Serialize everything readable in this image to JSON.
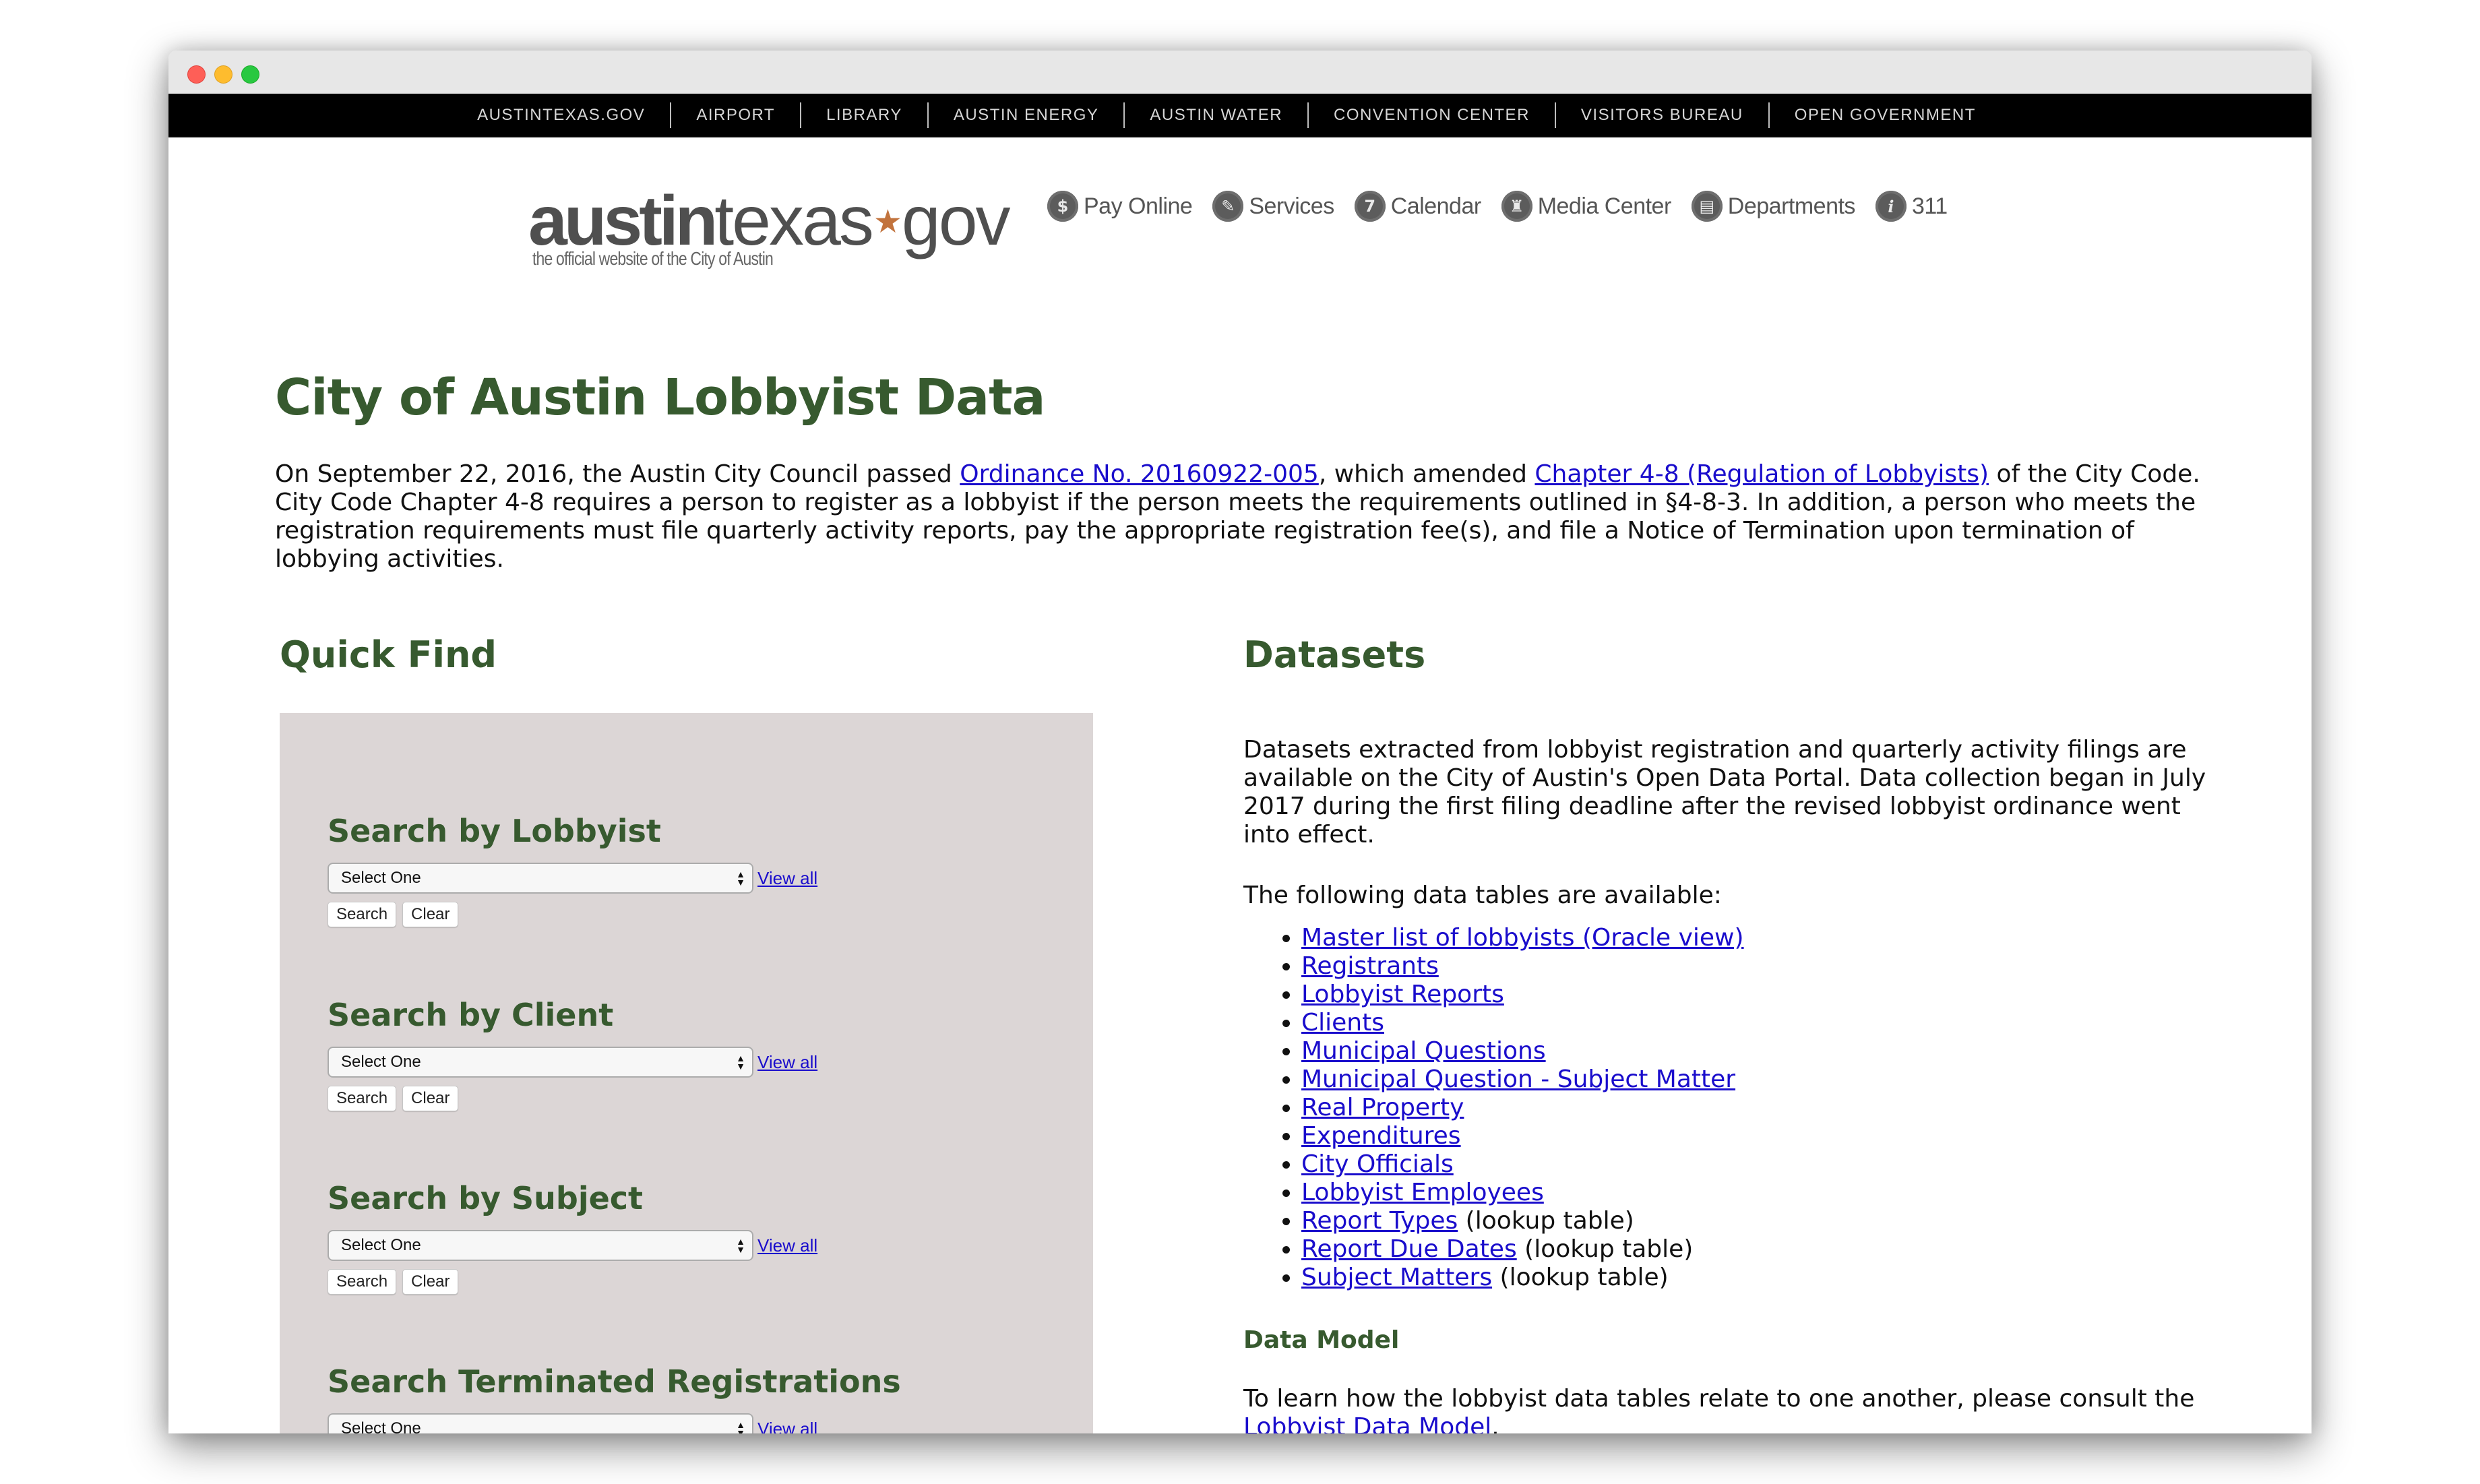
{
  "window": {
    "controls": [
      "close",
      "minimize",
      "zoom"
    ]
  },
  "top_nav": {
    "items": [
      {
        "label": "AUSTINTEXAS.GOV"
      },
      {
        "label": "AIRPORT"
      },
      {
        "label": "LIBRARY"
      },
      {
        "label": "AUSTIN ENERGY"
      },
      {
        "label": "AUSTIN WATER"
      },
      {
        "label": "CONVENTION CENTER"
      },
      {
        "label": "VISITORS BUREAU"
      },
      {
        "label": "OPEN GOVERNMENT"
      }
    ]
  },
  "logo": {
    "bold_part": "austin",
    "light_part": "texas",
    "star": "★",
    "suffix": "gov",
    "tagline": "the official website of the City of Austin"
  },
  "icon_nav": {
    "items": [
      {
        "label": "Pay Online",
        "icon": "pay-online-icon",
        "glyph": "$"
      },
      {
        "label": "Services",
        "icon": "services-icon",
        "glyph": "✎"
      },
      {
        "label": "Calendar",
        "icon": "calendar-icon",
        "glyph": "7"
      },
      {
        "label": "Media Center",
        "icon": "media-center-icon",
        "glyph": "♜"
      },
      {
        "label": "Departments",
        "icon": "departments-icon",
        "glyph": "▤"
      },
      {
        "label": "311",
        "icon": "info-icon",
        "glyph": "i"
      }
    ]
  },
  "page": {
    "title": "City of Austin Lobbyist Data",
    "intro": {
      "part1": "On September 22, 2016, the Austin City Council passed ",
      "link1": "Ordinance No. 20160922-005",
      "part2": ", which amended ",
      "link2": "Chapter 4-8 (Regulation of Lobbyists)",
      "part3": " of the City Code. City Code Chapter 4-8 requires a person to register as a lobbyist if the person meets the requirements outlined in §4-8-3. In addition, a person who meets the registration requirements must file quarterly activity reports, pay the appropriate registration fee(s), and file a Notice of Termination upon termination of lobbying activities."
    }
  },
  "quick_find": {
    "heading": "Quick Find",
    "sections": [
      {
        "title": "Search by Lobbyist",
        "select_value": "Select One",
        "view_all": "View all",
        "search_label": "Search",
        "clear_label": "Clear"
      },
      {
        "title": "Search by Client",
        "select_value": "Select One",
        "view_all": "View all",
        "search_label": "Search",
        "clear_label": "Clear"
      },
      {
        "title": "Search by Subject",
        "select_value": "Select One",
        "view_all": "View all",
        "search_label": "Search",
        "clear_label": "Clear"
      },
      {
        "title": "Search Terminated Registrations",
        "select_value": "Select One",
        "view_all": "View all"
      }
    ]
  },
  "datasets": {
    "heading": "Datasets",
    "description": "Datasets extracted from lobbyist registration and quarterly activity filings are available on the City of Austin's Open Data Portal. Data collection began in July 2017 during the first filing deadline after the revised lobbyist ordinance went into effect.",
    "tables_intro": "The following data tables are available:",
    "tables": [
      {
        "link": "Master list of lobbyists (Oracle view)",
        "note": ""
      },
      {
        "link": "Registrants",
        "note": ""
      },
      {
        "link": "Lobbyist Reports",
        "note": ""
      },
      {
        "link": "Clients",
        "note": ""
      },
      {
        "link": "Municipal Questions",
        "note": ""
      },
      {
        "link": "Municipal Question - Subject Matter",
        "note": ""
      },
      {
        "link": "Real Property",
        "note": ""
      },
      {
        "link": "Expenditures",
        "note": ""
      },
      {
        "link": "City Officials",
        "note": ""
      },
      {
        "link": "Lobbyist Employees",
        "note": ""
      },
      {
        "link": "Report Types",
        "note": " (lookup table)"
      },
      {
        "link": "Report Due Dates",
        "note": " (lookup table)"
      },
      {
        "link": "Subject Matters",
        "note": " (lookup table)"
      }
    ],
    "data_model": {
      "heading": "Data Model",
      "text": "To learn how the lobbyist data tables relate to one another, please consult the ",
      "link": "Lobbyist Data Model",
      "suffix": "."
    }
  },
  "colors": {
    "heading_green": "#375a2f",
    "link_blue": "#1a0dcc",
    "panel_bg": "#dcd6d6",
    "nav_bg": "#000000",
    "logo_star": "#c2733d"
  }
}
